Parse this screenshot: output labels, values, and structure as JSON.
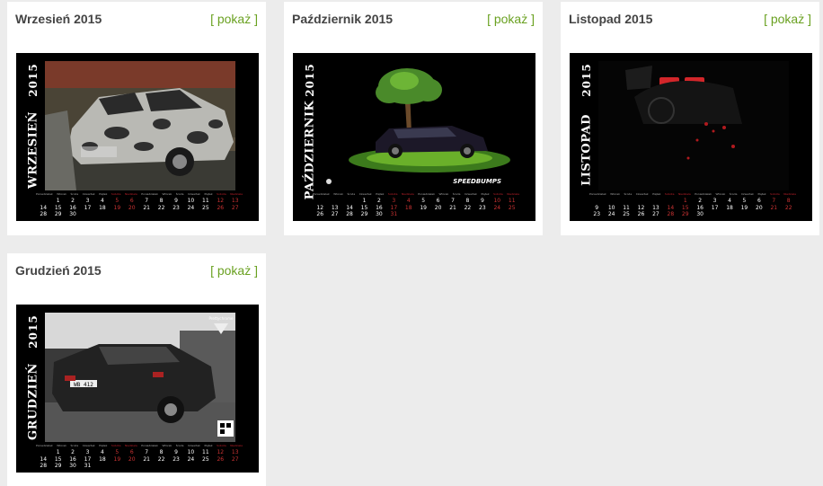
{
  "show_label": "[ pokaż ]",
  "cards": [
    {
      "title": "Wrzesień 2015",
      "year": "2015",
      "month": "WRZESIEŃ",
      "weeks": [
        [
          "",
          "1",
          "2",
          "3",
          "4",
          "5",
          "6",
          "7",
          "8",
          "9",
          "10",
          "11",
          "12",
          "13"
        ],
        [
          "14",
          "15",
          "16",
          "17",
          "18",
          "19",
          "20",
          "21",
          "22",
          "23",
          "24",
          "25",
          "26",
          "27"
        ],
        [
          "28",
          "29",
          "30",
          "",
          "",
          "",
          "",
          "",
          "",
          "",
          "",
          "",
          "",
          ""
        ]
      ]
    },
    {
      "title": "Październik 2015",
      "year": "2015",
      "month": "PAŹDZIERNIK",
      "weeks": [
        [
          "",
          "",
          "",
          "1",
          "2",
          "3",
          "4",
          "5",
          "6",
          "7",
          "8",
          "9",
          "10",
          "11"
        ],
        [
          "12",
          "13",
          "14",
          "15",
          "16",
          "17",
          "18",
          "19",
          "20",
          "21",
          "22",
          "23",
          "24",
          "25"
        ],
        [
          "26",
          "27",
          "28",
          "29",
          "30",
          "31",
          "",
          "",
          "",
          "",
          "",
          "",
          "",
          ""
        ]
      ]
    },
    {
      "title": "Listopad 2015",
      "year": "2015",
      "month": "LISTOPAD",
      "weeks": [
        [
          "",
          "",
          "",
          "",
          "",
          "",
          "1",
          "2",
          "3",
          "4",
          "5",
          "6",
          "7",
          "8"
        ],
        [
          "9",
          "10",
          "11",
          "12",
          "13",
          "14",
          "15",
          "16",
          "17",
          "18",
          "19",
          "20",
          "21",
          "22"
        ],
        [
          "23",
          "24",
          "25",
          "26",
          "27",
          "28",
          "29",
          "30",
          "",
          "",
          "",
          "",
          "",
          ""
        ]
      ]
    },
    {
      "title": "Grudzień 2015",
      "year": "2015",
      "month": "GRUDZIEŃ",
      "weeks": [
        [
          "",
          "1",
          "2",
          "3",
          "4",
          "5",
          "6",
          "7",
          "8",
          "9",
          "10",
          "11",
          "12",
          "13"
        ],
        [
          "14",
          "15",
          "16",
          "17",
          "18",
          "19",
          "20",
          "21",
          "22",
          "23",
          "24",
          "25",
          "26",
          "27"
        ],
        [
          "28",
          "29",
          "30",
          "31",
          "",
          "",
          "",
          "",
          "",
          "",
          "",
          "",
          "",
          ""
        ]
      ]
    }
  ],
  "colors": {
    "accent": "#6aa121",
    "weekend": "#c33333",
    "background": "#ececec"
  }
}
